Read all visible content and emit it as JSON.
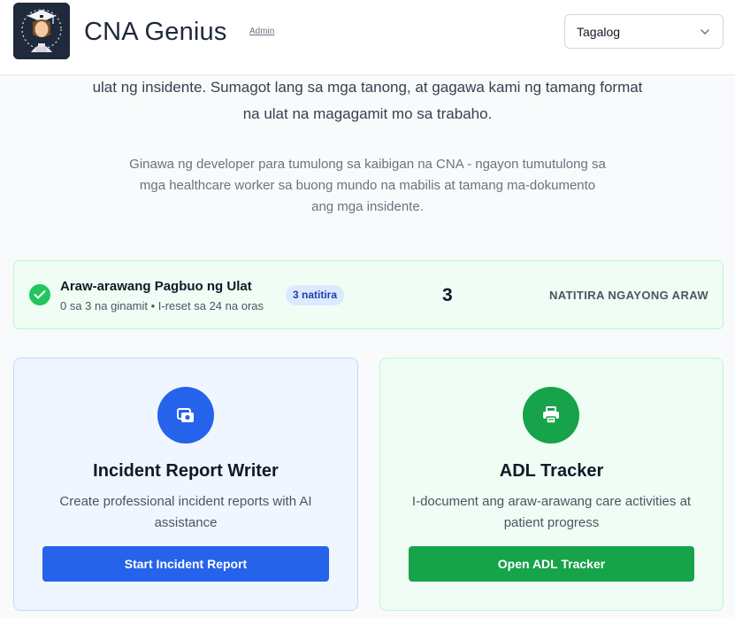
{
  "header": {
    "app_title": "CNA Genius",
    "admin_link": "Admin",
    "language": {
      "selected": "Tagalog"
    }
  },
  "intro": {
    "line1": "ulat ng insidente. Sumagot lang sa mga tanong, at gagawa kami ng tamang format",
    "line2": "na ulat na magagamit mo sa trabaho.",
    "credit_line1": "Ginawa ng developer para tumulong sa kaibigan na CNA - ngayon tumutulong sa",
    "credit_line2": "mga healthcare worker sa buong mundo na mabilis at tamang ma-dokumento",
    "credit_line3": "ang mga insidente."
  },
  "usage": {
    "title": "Araw-arawang Pagbuo ng Ulat",
    "subtitle": "0 sa 3 na ginamit • I-reset sa 24 na oras",
    "badge": "3 natitira",
    "count": "3",
    "count_label": "NATITIRA NGAYONG ARAW"
  },
  "cards": [
    {
      "title": "Incident Report Writer",
      "description": "Create professional incident reports with AI assistance",
      "button": "Start Incident Report",
      "icon": "camera-icon",
      "color": "#2563eb"
    },
    {
      "title": "ADL Tracker",
      "description": "I-document ang araw-arawang care activities at patient progress",
      "button": "Open ADL Tracker",
      "icon": "printer-icon",
      "color": "#16a34a"
    }
  ]
}
